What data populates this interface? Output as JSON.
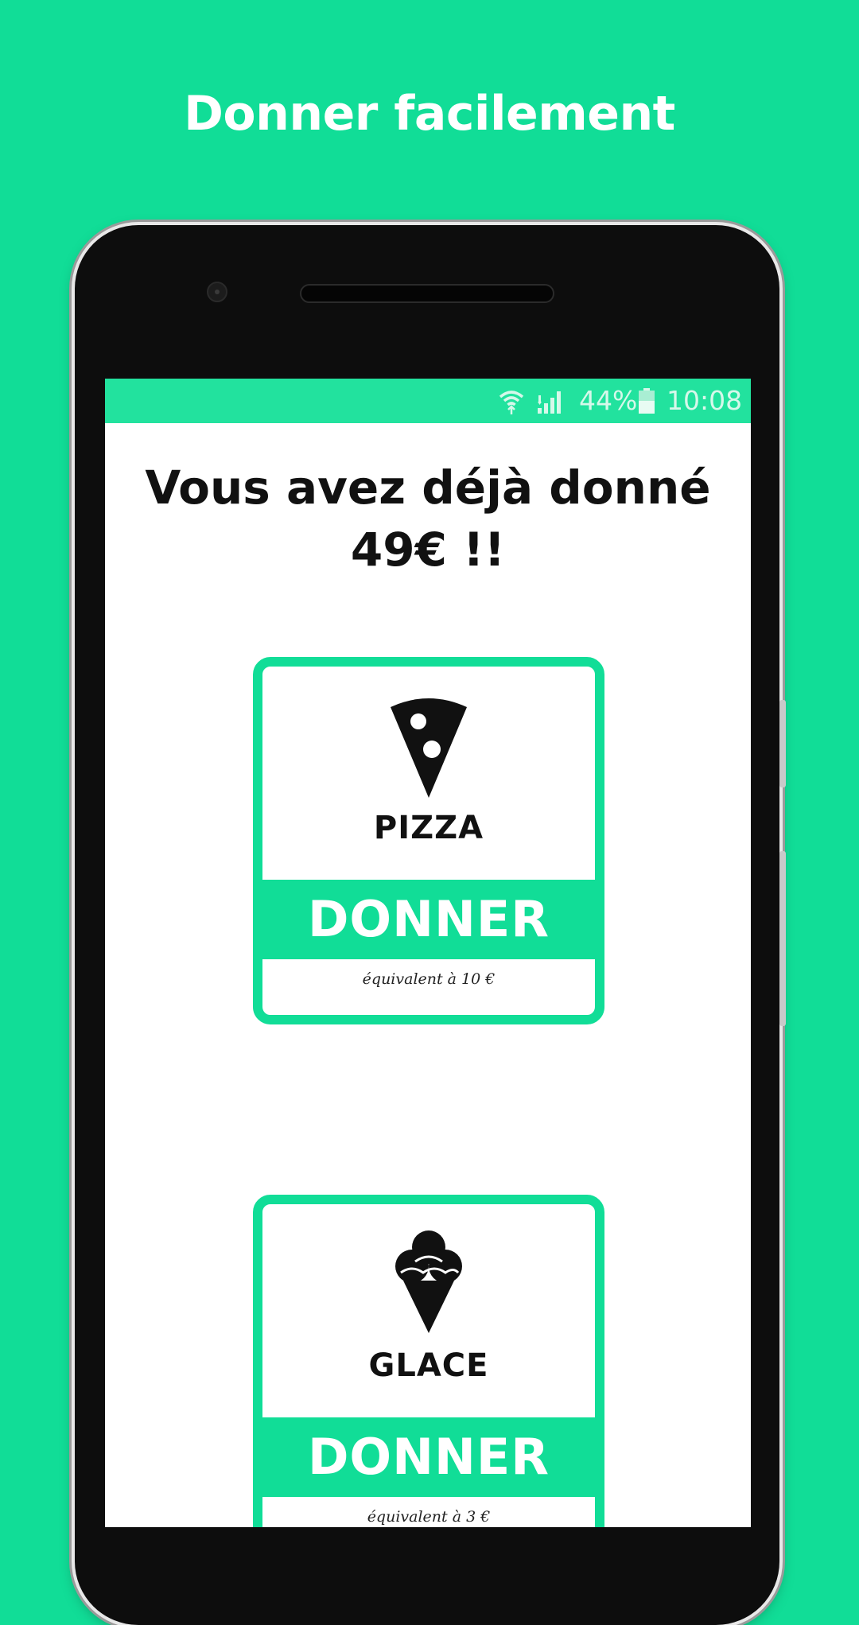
{
  "headline": "Donner facilement",
  "status_bar": {
    "battery_percent": "44%",
    "time": "10:08"
  },
  "donation_total": {
    "line1": "Vous avez déjà donné",
    "line2": "49€ !!"
  },
  "items": [
    {
      "icon": "pizza-slice-icon",
      "label": "PIZZA",
      "button": "DONNER",
      "equivalent": "équivalent à 10 €"
    },
    {
      "icon": "ice-cream-cone-icon",
      "label": "GLACE",
      "button": "DONNER",
      "equivalent": "équivalent à 3 €"
    }
  ],
  "colors": {
    "brand_green": "#11dd97",
    "status_bar_green": "#22e29e",
    "text_dark": "#111111"
  }
}
